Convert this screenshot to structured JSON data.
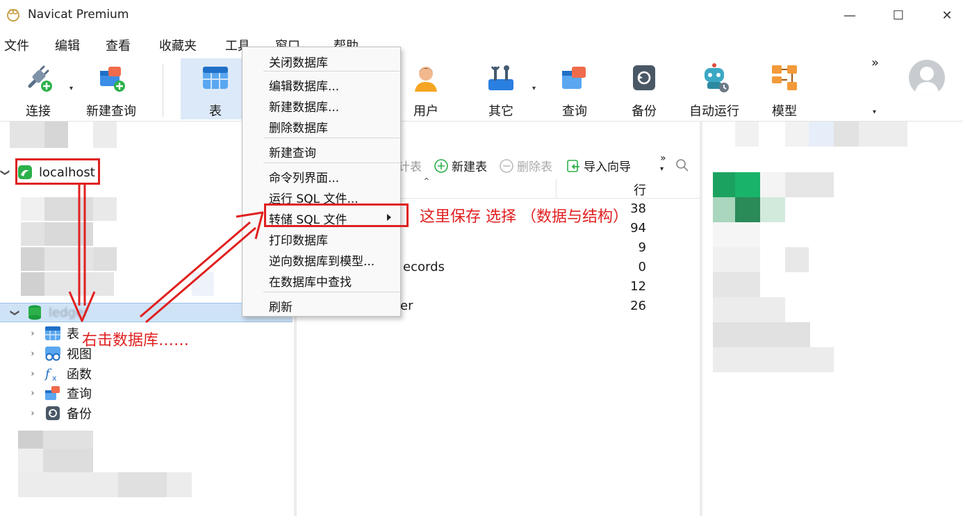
{
  "window": {
    "title": "Navicat Premium",
    "minimize": "—",
    "maximize": "☐",
    "close": "✕"
  },
  "menubar": [
    "文件",
    "编辑",
    "查看",
    "收藏夹",
    "工具",
    "窗口",
    "帮助"
  ],
  "toolbar": {
    "connect": "连接",
    "new_query": "新建查询",
    "table": "表",
    "user": "用户",
    "other": "其它",
    "query": "查询",
    "backup": "备份",
    "auto_run": "自动运行",
    "model": "模型",
    "overflow": "»"
  },
  "tree": {
    "connection": "localhost",
    "database": "ledger",
    "children": [
      "表",
      "视图",
      "函数",
      "查询",
      "备份"
    ]
  },
  "object_toolbar": {
    "design_table": "计表",
    "new_table": "新建表",
    "delete_table": "删除表",
    "import_wizard": "导入向导",
    "overflow": "»"
  },
  "object_list": {
    "col_rows": "行",
    "rows": [
      {
        "name": "",
        "count": "38"
      },
      {
        "name": "",
        "count": "94"
      },
      {
        "name": "",
        "count": "9"
      },
      {
        "name": "ecords",
        "count": "0"
      },
      {
        "name": "",
        "count": "12"
      },
      {
        "name": "er",
        "count": "26"
      }
    ]
  },
  "context_menu": {
    "items": [
      "关闭数据库",
      "编辑数据库...",
      "新建数据库...",
      "删除数据库",
      "新建查询",
      "命令列界面...",
      "运行 SQL 文件...",
      "转储 SQL 文件",
      "打印数据库",
      "逆向数据库到模型...",
      "在数据库中查找",
      "刷新"
    ]
  },
  "annotations": {
    "save_here": "这里保存  选择  （数据与结构）",
    "right_click": "右击数据库……"
  },
  "colors": {
    "accent_red": "#e02020",
    "selection": "#cfe3f7",
    "navicat_green": "#2bb04a"
  }
}
